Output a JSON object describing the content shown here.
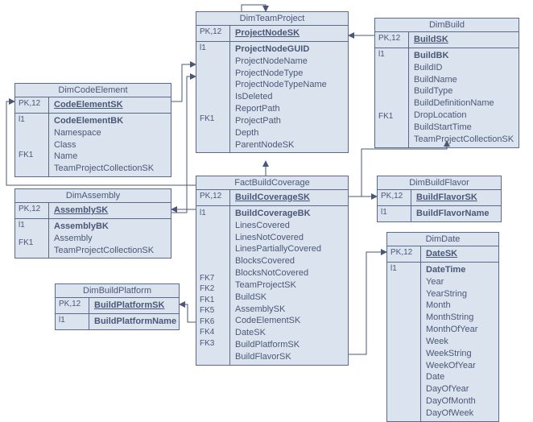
{
  "entities": {
    "dimCodeElement": {
      "title": "DimCodeElement",
      "pkKey": "PK,12",
      "pkField": "CodeElementSK",
      "secKey": "l1",
      "secFields": [
        "CodeElementBK",
        "Namespace",
        "Class",
        "Name",
        "TeamProjectCollectionSK"
      ],
      "secFKs": [
        "",
        "",
        "",
        "",
        "FK1"
      ]
    },
    "dimAssembly": {
      "title": "DimAssembly",
      "pkKey": "PK,12",
      "pkField": "AssemblySK",
      "secKey": "l1",
      "secFields": [
        "AssemblyBK",
        "Assembly",
        "TeamProjectCollectionSK"
      ],
      "secFKs": [
        "",
        "",
        "FK1"
      ]
    },
    "dimBuildPlatform": {
      "title": "DimBuildPlatform",
      "pkKey": "PK,12",
      "pkField": "BuildPlatformSK",
      "secKey": "l1",
      "secFields": [
        "BuildPlatformName"
      ]
    },
    "dimTeamProject": {
      "title": "DimTeamProject",
      "pkKey": "PK,12",
      "pkField": "ProjectNodeSK",
      "secKey": "l1",
      "secFields": [
        "ProjectNodeGUID",
        "ProjectNodeName",
        "ProjectNodeType",
        "ProjectNodeTypeName",
        "IsDeleted",
        "ReportPath",
        "ProjectPath",
        "Depth",
        "ParentNodeSK"
      ],
      "secFKs": [
        "",
        "",
        "",
        "",
        "",
        "",
        "",
        "",
        "FK1"
      ]
    },
    "factBuildCoverage": {
      "title": "FactBuildCoverage",
      "pkKey": "PK,12",
      "pkField": "BuildCoverageSK",
      "secKey": "l1",
      "secFields": [
        "BuildCoverageBK",
        "LinesCovered",
        "LinesNotCovered",
        "LinesPartiallyCovered",
        "BlocksCovered",
        "BlocksNotCovered",
        "TeamProjectSK",
        "BuildSK",
        "AssemblySK",
        "CodeElementSK",
        "DateSK",
        "BuildPlatformSK",
        "BuildFlavorSK"
      ],
      "secFKs": [
        "",
        "",
        "",
        "",
        "",
        "",
        "FK7",
        "FK2",
        "FK1",
        "FK5",
        "FK6",
        "FK4",
        "FK3"
      ]
    },
    "dimBuild": {
      "title": "DimBuild",
      "pkKey": "PK,12",
      "pkField": "BuildSK",
      "secKey": "l1",
      "secFields": [
        "BuildBK",
        "BuildID",
        "BuildName",
        "BuildType",
        "BuildDefinitionName",
        "DropLocation",
        "BuildStartTime",
        "TeamProjectCollectionSK"
      ],
      "secFKs": [
        "",
        "",
        "",
        "",
        "",
        "",
        "",
        "FK1"
      ]
    },
    "dimBuildFlavor": {
      "title": "DimBuildFlavor",
      "pkKey": "PK,12",
      "pkField": "BuildFlavorSK",
      "secKey": "l1",
      "secFields": [
        "BuildFlavorName"
      ]
    },
    "dimDate": {
      "title": "DimDate",
      "pkKey": "PK,12",
      "pkField": "DateSK",
      "secKey": "l1",
      "secFields": [
        "DateTime",
        "Year",
        "YearString",
        "Month",
        "MonthString",
        "MonthOfYear",
        "Week",
        "WeekString",
        "WeekOfYear",
        "Date",
        "DayOfYear",
        "DayOfMonth",
        "DayOfWeek"
      ]
    }
  }
}
